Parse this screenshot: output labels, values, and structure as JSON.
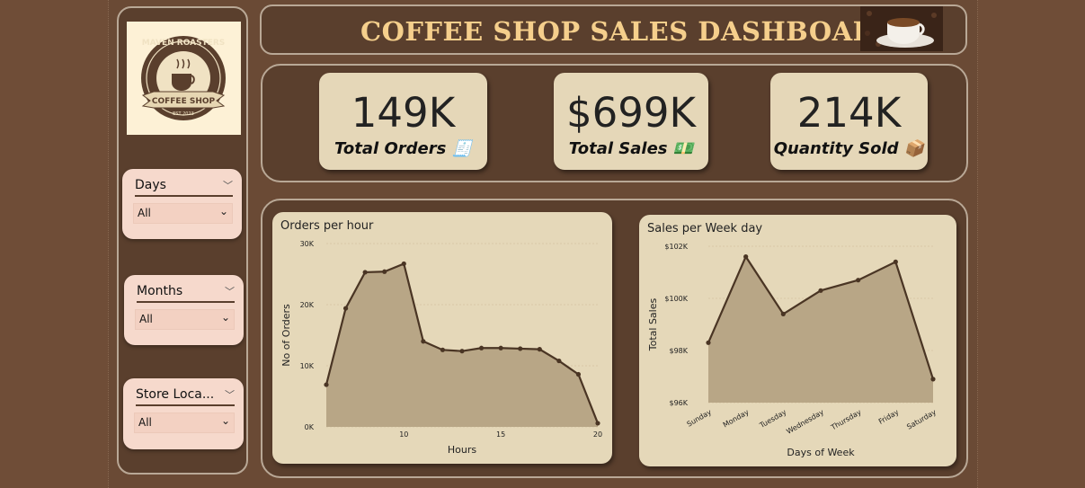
{
  "header": {
    "title": "COFFEE SHOP SALES DASHBOARD"
  },
  "logo": {
    "line1": "MAVEN ROASTERS",
    "line2": "COFFEE SHOP",
    "line3": "EST 2023"
  },
  "slicers": [
    {
      "title": "Days",
      "value": "All"
    },
    {
      "title": "Months",
      "value": "All"
    },
    {
      "title": "Store Loca...",
      "value": "All"
    }
  ],
  "kpis": [
    {
      "value": "149K",
      "label": "Total Orders",
      "icon": "🧾"
    },
    {
      "value": "$699K",
      "label": "Total Sales",
      "icon": "💵"
    },
    {
      "value": "214K",
      "label": "Quantity Sold",
      "icon": "📦"
    }
  ],
  "colors": {
    "accent": "#f5cf8c",
    "line": "#4a3524",
    "area": "#b8a686"
  },
  "chart_data": [
    {
      "type": "area",
      "title": "Orders per hour",
      "xlabel": "Hours",
      "ylabel": "No of Orders",
      "xlim": [
        6,
        20
      ],
      "ylim": [
        0,
        30000
      ],
      "xticks": [
        "10",
        "15",
        "20"
      ],
      "yticks": [
        "0K",
        "10K",
        "20K",
        "30K"
      ],
      "x": [
        6,
        7,
        8,
        9,
        10,
        11,
        12,
        13,
        14,
        15,
        16,
        17,
        18,
        19,
        20
      ],
      "values": [
        6900,
        19400,
        25300,
        25400,
        26700,
        14000,
        12600,
        12400,
        12900,
        12900,
        12800,
        12700,
        10800,
        8600,
        600
      ]
    },
    {
      "type": "area",
      "title": "Sales per Week day",
      "xlabel": "Days of Week",
      "ylabel": "Total Sales",
      "ylim": [
        96000,
        102000
      ],
      "yticks": [
        "$96K",
        "$98K",
        "$100K",
        "$102K"
      ],
      "categories": [
        "Sunday",
        "Monday",
        "Tuesday",
        "Wednesday",
        "Thursday",
        "Friday",
        "Saturday"
      ],
      "values": [
        98300,
        101600,
        99400,
        100300,
        100700,
        101400,
        96900
      ]
    }
  ]
}
